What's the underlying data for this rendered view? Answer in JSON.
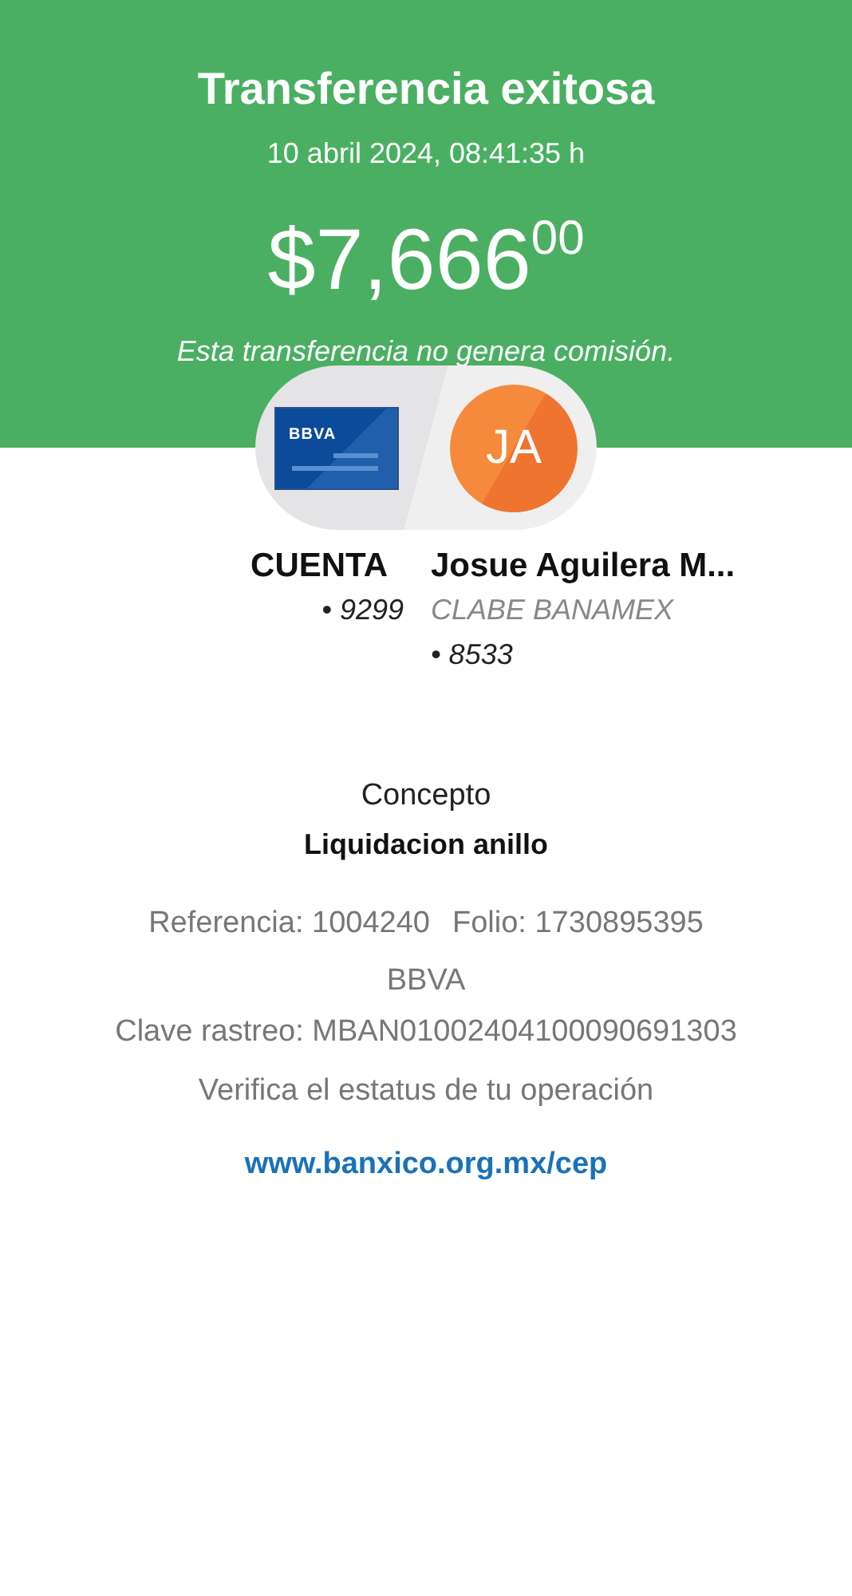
{
  "header": {
    "title": "Transferencia exitosa",
    "datetime": "10 abril 2024, 08:41:35 h",
    "amount": "$7,666$^{00}$",
    "note": "Esta transferencia no genera comisión."
  },
  "origin": {
    "card_brand": "BBVA",
    "label": "CUENTA",
    "number": "• 9299"
  },
  "destination": {
    "initials": "JA",
    "name": "Josue Aguilera M...",
    "bank": "CLABE BANAMEX",
    "number": "• 8533"
  },
  "concept": {
    "label": "Concepto",
    "value": "Liquidacion anillo"
  },
  "details": {
    "reference": "Referencia: 1004240",
    "folio": "Folio: 1730895395",
    "bank": "BBVA",
    "tracking": "Clave rastreo: MBAN01002404100090691303",
    "verify": "Verifica el estatus de tu operación",
    "link": "www.banxico.org.mx/cep"
  }
}
